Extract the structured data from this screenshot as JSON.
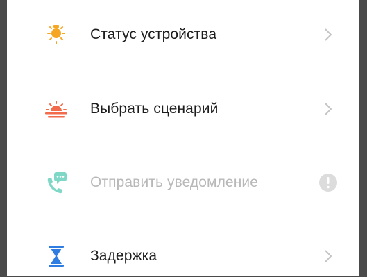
{
  "menu": {
    "items": [
      {
        "label": "Статус устройства",
        "icon": "lightbulb-icon",
        "color": "#f5a623",
        "enabled": true,
        "trailing": "chevron-right-icon"
      },
      {
        "label": "Выбрать сценарий",
        "icon": "sunrise-icon",
        "color": "#f26b4a",
        "enabled": true,
        "trailing": "chevron-right-icon"
      },
      {
        "label": "Отправить уведомление",
        "icon": "phone-message-icon",
        "color": "#7fd8c6",
        "enabled": false,
        "trailing": "alert-icon"
      },
      {
        "label": "Задержка",
        "icon": "hourglass-icon",
        "color": "#2f7de1",
        "enabled": true,
        "trailing": "chevron-right-icon"
      }
    ]
  },
  "colors": {
    "chevron": "#c4c4c4",
    "disabled_text": "#b8b8b8",
    "alert_bg": "#dcdcdc"
  }
}
